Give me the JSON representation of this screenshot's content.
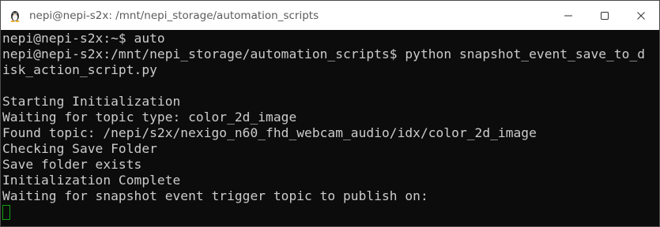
{
  "window": {
    "title": "nepi@nepi-s2x: /mnt/nepi_storage/automation_scripts",
    "icon": "linux-penguin-icon",
    "controls": [
      "minimize-icon",
      "maximize-icon",
      "close-icon"
    ]
  },
  "terminal": {
    "lines": [
      "nepi@nepi-s2x:~$ auto",
      "nepi@nepi-s2x:/mnt/nepi_storage/automation_scripts$ python snapshot_event_save_to_d",
      "isk_action_script.py",
      "",
      "Starting Initialization",
      "Waiting for topic type: color_2d_image",
      "Found topic: /nepi/s2x/nexigo_n60_fhd_webcam_audio/idx/color_2d_image",
      "Checking Save Folder",
      "Save folder exists",
      "Initialization Complete",
      "Waiting for snapshot event trigger topic to publish on:"
    ],
    "cursor_color": "#13a10e",
    "text_color": "#cccccc",
    "background_color": "#0c0c0c"
  }
}
